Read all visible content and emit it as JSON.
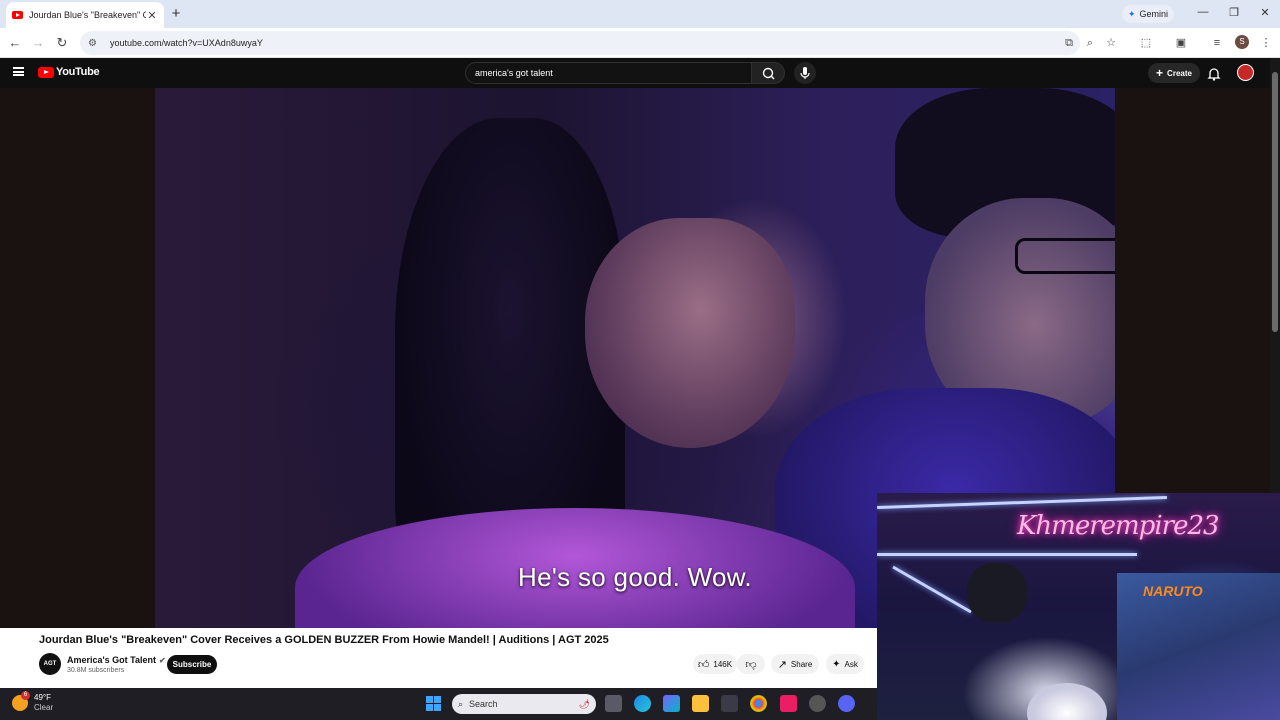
{
  "browser": {
    "tab_title": "Jourdan Blue's \"Breakeven\" Cov",
    "new_tab": "+",
    "gemini_label": "Gemini",
    "url": "youtube.com/watch?v=UXAdn8uwyaY",
    "profile_initial": "S"
  },
  "youtube": {
    "logo_text": "YouTube",
    "search_value": "america's got talent",
    "create_label": "Create"
  },
  "video": {
    "caption": "He's so good. Wow.",
    "title": "Jourdan Blue's \"Breakeven\" Cover Receives a GOLDEN BUZZER From Howie Mandel! | Auditions | AGT 2025",
    "channel_name": "America's Got Talent",
    "channel_avatar_text": "AGT",
    "subscribers": "30.8M subscribers",
    "subscribe_label": "Subscribe",
    "likes": "146K",
    "share_label": "Share",
    "ask_label": "Ask"
  },
  "webcam": {
    "neon_sign": "Khmerempire23",
    "poster_text": "NARUTO"
  },
  "taskbar": {
    "weather_temp": "49°F",
    "weather_cond": "Clear",
    "weather_badge": "6",
    "search_placeholder": "Search"
  },
  "colors": {
    "youtube_red": "#ff0000",
    "accent_blue": "#3ea6ff"
  }
}
